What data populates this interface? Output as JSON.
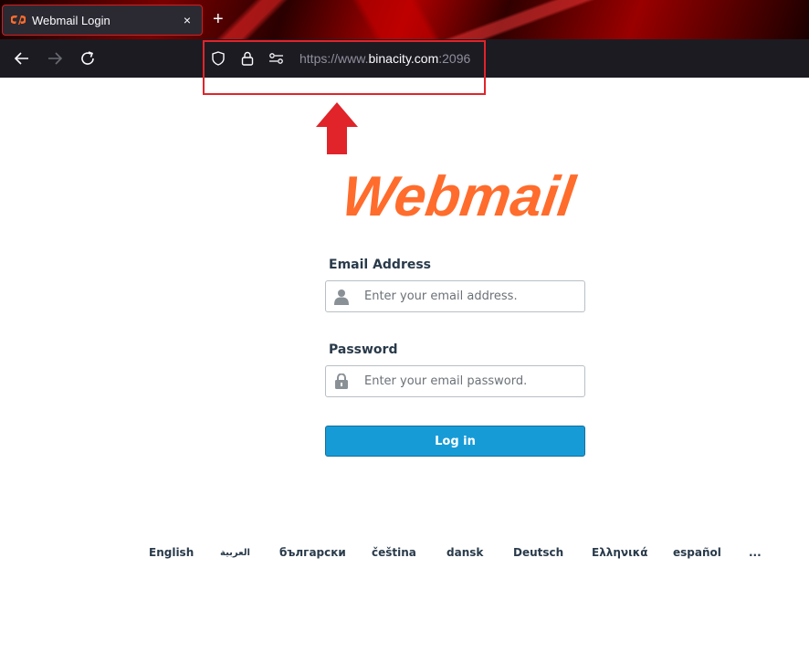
{
  "browser": {
    "tab": {
      "title": "Webmail Login",
      "close_glyph": "×",
      "favicon": "cpanel-icon"
    },
    "new_tab_glyph": "+",
    "nav": {
      "back": "back-arrow-icon",
      "forward": "forward-arrow-icon",
      "reload": "reload-icon"
    },
    "url": {
      "scheme": "https://www.",
      "host": "binacity.com",
      "port": ":2096"
    },
    "url_icons": [
      "shield-icon",
      "lock-icon",
      "permissions-icon"
    ]
  },
  "annotation": {
    "color": "#e0242a"
  },
  "page": {
    "logo_text": "Webmail",
    "logo_color": "#ff6c2c",
    "email": {
      "label": "Email Address",
      "placeholder": "Enter your email address."
    },
    "password": {
      "label": "Password",
      "placeholder": "Enter your email password."
    },
    "login_button": "Log in",
    "accent": "#179bd7",
    "languages": [
      "English",
      "العربية",
      "български",
      "čeština",
      "dansk",
      "Deutsch",
      "Ελληνικά",
      "español"
    ],
    "more_languages": "..."
  }
}
